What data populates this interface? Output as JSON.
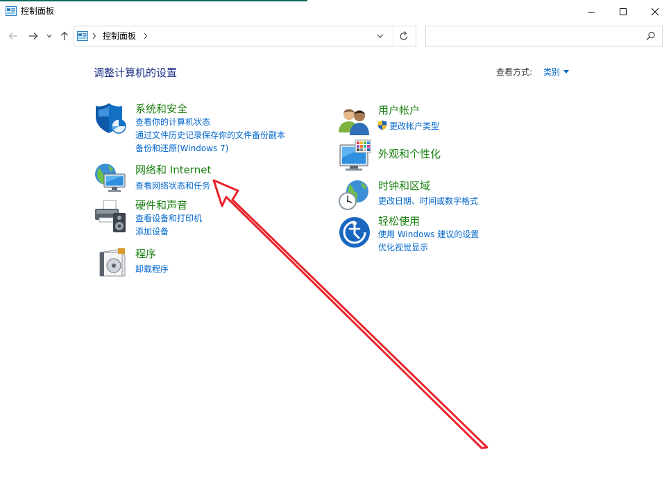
{
  "window": {
    "title": "控制面板"
  },
  "address": {
    "crumb": "控制面板"
  },
  "search": {
    "placeholder": ""
  },
  "content": {
    "heading": "调整计算机的设置",
    "view_by_label": "查看方式:",
    "view_by_value": "类别"
  },
  "categories": {
    "system": {
      "title": "系统和安全",
      "links": [
        "查看你的计算机状态",
        "通过文件历史记录保存你的文件备份副本",
        "备份和还原(Windows 7)"
      ]
    },
    "network": {
      "title": "网络和 Internet",
      "links": [
        "查看网络状态和任务"
      ]
    },
    "hardware": {
      "title": "硬件和声音",
      "links": [
        "查看设备和打印机",
        "添加设备"
      ]
    },
    "programs": {
      "title": "程序",
      "links": [
        "卸载程序"
      ]
    },
    "users": {
      "title": "用户帐户",
      "links": [
        "更改帐户类型"
      ]
    },
    "appearance": {
      "title": "外观和个性化",
      "links": []
    },
    "clock": {
      "title": "时钟和区域",
      "links": [
        "更改日期、时间或数字格式"
      ]
    },
    "ease": {
      "title": "轻松使用",
      "links": [
        "使用 Windows 建议的设置",
        "优化视觉显示"
      ]
    }
  },
  "colors": {
    "category_title": "#1a7f10",
    "link": "#0066cc",
    "heading": "#1e3287",
    "annotation_arrow": "#e8232b"
  },
  "icons": {
    "system": "shield-icon",
    "network": "network-globe-icon",
    "hardware": "printer-speaker-icon",
    "programs": "program-disc-icon",
    "users": "users-icon",
    "appearance": "monitor-palette-icon",
    "clock": "clock-globe-icon",
    "ease": "ease-of-access-icon"
  }
}
